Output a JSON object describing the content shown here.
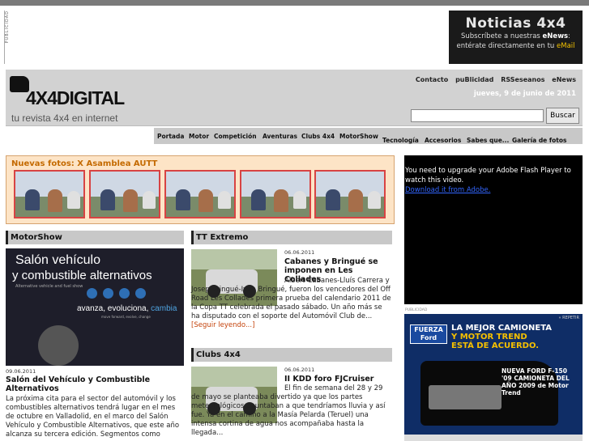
{
  "ad_label": "PUBLICIDAD",
  "top_ad": {
    "title": "Noticias 4x4",
    "line1_pre": "Subscríbete a nuestras ",
    "line1_bold": "eNews",
    "line1_post": ":",
    "line2_pre": "entérate directamente en tu ",
    "line2_link": "eMail"
  },
  "header": {
    "logo_text": "4X4DIGITAL",
    "tagline": "tu revista 4x4 en internet",
    "links": [
      "Contacto",
      "puBlicidad",
      "RSSeseanos",
      "eNews"
    ],
    "date": "jueves, 9 de junio de 2011",
    "search_value": "",
    "search_button": "Buscar"
  },
  "nav": [
    "Portada",
    "Motor",
    "Competición",
    "Aventuras",
    "Clubs 4x4",
    "MotorShow",
    "Tecnología",
    "Accesorios",
    "Sabes que...",
    "Galería de fotos"
  ],
  "gallery": {
    "title": "Nuevas fotos: X Asamblea AUTT",
    "thumb_count": 5
  },
  "flash": {
    "message": "You need to upgrade your Adobe Flash Player to watch this video.",
    "link": "Download it from Adobe."
  },
  "ad_right": {
    "small_label": "PUBLICIDAD",
    "repeat": "« REPETIR",
    "brand": "FUERZA Ford",
    "headline_1": "LA MEJOR CAMIONETA",
    "headline_2": "Y MOTOR TREND",
    "headline_3": "ESTÁ DE ACUERDO.",
    "sub": "NUEVA FORD F-150 '09 CAMIONETA DEL AÑO 2009 de Motor Trend"
  },
  "sections": {
    "motorshow": {
      "heading": "MotorShow",
      "img_line1": "Salón vehículo",
      "img_line2": "y combustible alternativos",
      "img_line3": "Alternative vehicle and fuel show",
      "img_tag_pre": "avanza, evoluciona, ",
      "img_tag_em": "cambia",
      "img_tag2": "move forward, evolve, change",
      "date": "09.06.2011",
      "title": "Salón del Vehículo y Combustible Alternativos",
      "body": "La próxima cita para el sector del automóvil y los combustibles alternativos tendrá lugar en el mes de octubre en Valladolid, en el marco del Salón Vehículo y Combustible Alternativos, que este año alcanza su tercera edición. Segmentos como"
    },
    "tt_extremo": {
      "heading": "TT Extremo",
      "date": "06.06.2011",
      "title": "Cabanes y Bringué se imponen en Les Collades",
      "body": "Albert Cabanes-Lluís Carrera y Josep Bringué-Ivan Bringué, fueron los vencedores del Off Road Les Collades primera prueba del calendario 2011 de la Copa TT celebrada el pasado sábado. Un año más se ha disputado con el soporte del Automóvil Club de...",
      "readmore": "[Seguir leyendo...]"
    },
    "clubs": {
      "heading": "Clubs 4x4",
      "date": "06.06.2011",
      "title": "II KDD foro FJCruiser",
      "body": "El fin de semana del 28 y 29 de mayo se planteaba divertido ya que los partes meteorológicos apuntaban a que tendríamos lluvia y así fue. Ya en el camino a la Masía Pelarda (Teruel) una intensa cortina de agua nos acompañaba hasta la llegada..."
    }
  }
}
